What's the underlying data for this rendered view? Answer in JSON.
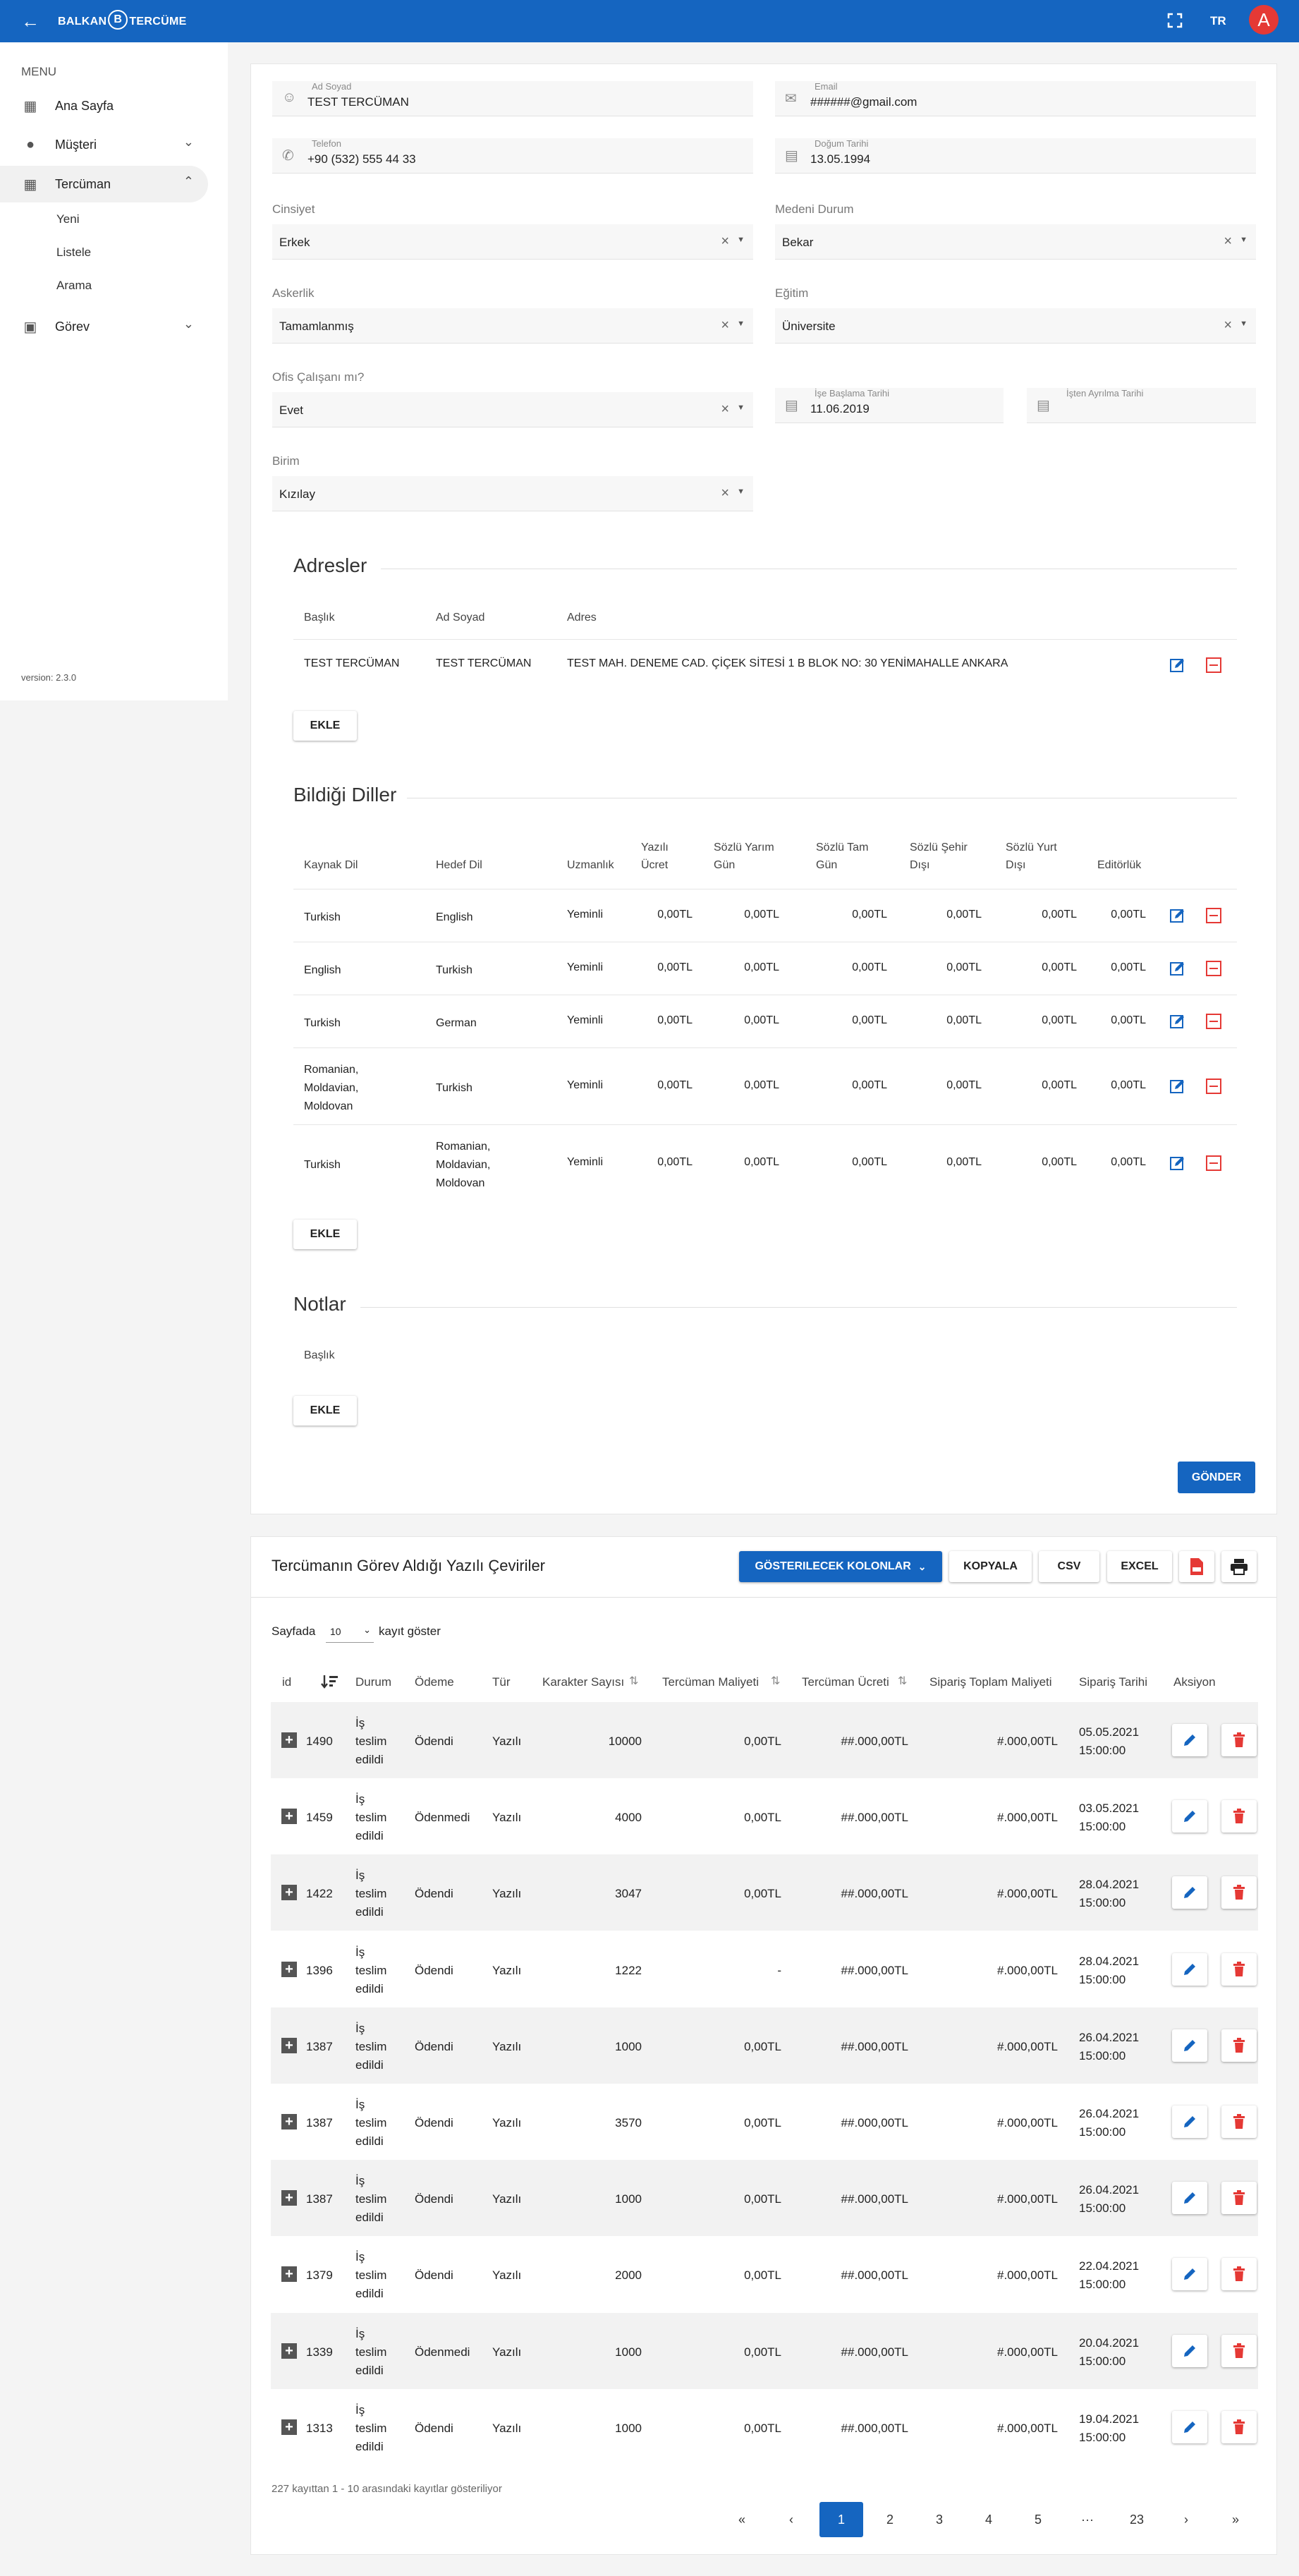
{
  "app": {
    "brand_left": "BALKAN",
    "brand_mid": "B",
    "brand_right": "TERCÜME",
    "lang": "TR",
    "avatar": "A",
    "fullscreen_icon": "fullscreen-icon",
    "back_icon": "arrow-left-icon"
  },
  "sidebar": {
    "menu_title": "MENU",
    "items": [
      {
        "label": "Ana Sayfa"
      },
      {
        "label": "Müşteri"
      },
      {
        "label": "Tercüman"
      },
      {
        "label": "Görev"
      }
    ],
    "sub": [
      "Yeni",
      "Listele",
      "Arama"
    ],
    "version": "version: 2.3.0"
  },
  "form": {
    "ad_soyad": {
      "label": "Ad Soyad",
      "value": "TEST TERCÜMAN"
    },
    "email": {
      "label": "Email",
      "value": "######@gmail.com"
    },
    "telefon": {
      "label": "Telefon",
      "value": "+90 (532) 555 44 33"
    },
    "dogum": {
      "label": "Doğum Tarihi",
      "value": "13.05.1994"
    },
    "cinsiyet": {
      "label": "Cinsiyet",
      "value": "Erkek"
    },
    "medeni": {
      "label": "Medeni Durum",
      "value": "Bekar"
    },
    "askerlik": {
      "label": "Askerlik",
      "value": "Tamamlanmış"
    },
    "egitim": {
      "label": "Eğitim",
      "value": "Üniversite"
    },
    "ofis": {
      "label": "Ofis Çalışanı mı?",
      "value": "Evet"
    },
    "ise_baslama": {
      "label": "İşe Başlama Tarihi",
      "value": "11.06.2019"
    },
    "isten_ayrilma": {
      "label": "İşten Ayrılma Tarihi",
      "value": ""
    },
    "birim": {
      "label": "Birim",
      "value": "Kızılay"
    }
  },
  "adresler": {
    "title": "Adresler",
    "headers": [
      "Başlık",
      "Ad Soyad",
      "Adres"
    ],
    "row": [
      "TEST TERCÜMAN",
      "TEST TERCÜMAN",
      "TEST MAH. DENEME CAD. ÇİÇEK SİTESİ 1 B BLOK NO: 30 YENİMAHALLE ANKARA"
    ],
    "add": "EKLE"
  },
  "diller": {
    "title": "Bildiği Diller",
    "headers": [
      "Kaynak Dil",
      "Hedef Dil",
      "Uzmanlık",
      "Yazılı",
      "Ücret",
      "Sözlü Yarım",
      "Gün",
      "Sözlü Tam",
      "Gün",
      "Sözlü Şehir",
      "Dışı",
      "Sözlü Yurt",
      "Dışı",
      "Editörlük"
    ],
    "rows": [
      {
        "src": "Turkish",
        "dst": "English",
        "uz": "Yeminli",
        "v": [
          "0,00TL",
          "0,00TL",
          "0,00TL",
          "0,00TL",
          "0,00TL",
          "0,00TL"
        ]
      },
      {
        "src": "English",
        "dst": "Turkish",
        "uz": "Yeminli",
        "v": [
          "0,00TL",
          "0,00TL",
          "0,00TL",
          "0,00TL",
          "0,00TL",
          "0,00TL"
        ]
      },
      {
        "src": "Turkish",
        "dst": "German",
        "uz": "Yeminli",
        "v": [
          "0,00TL",
          "0,00TL",
          "0,00TL",
          "0,00TL",
          "0,00TL",
          "0,00TL"
        ]
      },
      {
        "src": "Romanian,\nMoldavian,\nMoldovan",
        "dst": "Turkish",
        "uz": "Yeminli",
        "v": [
          "0,00TL",
          "0,00TL",
          "0,00TL",
          "0,00TL",
          "0,00TL",
          "0,00TL"
        ]
      },
      {
        "src": "Turkish",
        "dst": "Romanian,\nMoldavian,\nMoldovan",
        "uz": "Yeminli",
        "v": [
          "0,00TL",
          "0,00TL",
          "0,00TL",
          "0,00TL",
          "0,00TL",
          "0,00TL"
        ]
      }
    ],
    "add": "EKLE"
  },
  "notlar": {
    "title": "Notlar",
    "header": "Başlık",
    "add": "EKLE"
  },
  "submit": "GÖNDER",
  "gorev": {
    "title": "Tercümanın Görev Aldığı Yazılı Çeviriler",
    "buttons": {
      "cols": "GÖSTERILECEK KOLONLAR",
      "copy": "KOPYALA",
      "csv": "CSV",
      "excel": "EXCEL"
    },
    "length": {
      "pre": "Sayfada",
      "value": "10",
      "post": "kayıt göster"
    },
    "headers": [
      "id",
      "Durum",
      "Ödeme",
      "Tür",
      "Karakter Sayısı",
      "Tercüman Maliyeti",
      "Tercüman Ücreti",
      "Sipariş Toplam Maliyeti",
      "Sipariş Tarihi",
      "Aksiyon"
    ],
    "rows": [
      {
        "id": "1490",
        "durum": "İş\nteslim\nedildi",
        "odeme": "Ödendi",
        "tur": "Yazılı",
        "kar": "10000",
        "mal": "0,00TL",
        "ucr": "##.000,00TL",
        "top": "#.000,00TL",
        "tar": "05.05.2021\n15:00:00"
      },
      {
        "id": "1459",
        "durum": "İş\nteslim\nedildi",
        "odeme": "Ödenmedi",
        "tur": "Yazılı",
        "kar": "4000",
        "mal": "0,00TL",
        "ucr": "##.000,00TL",
        "top": "#.000,00TL",
        "tar": "03.05.2021\n15:00:00"
      },
      {
        "id": "1422",
        "durum": "İş\nteslim\nedildi",
        "odeme": "Ödendi",
        "tur": "Yazılı",
        "kar": "3047",
        "mal": "0,00TL",
        "ucr": "##.000,00TL",
        "top": "#.000,00TL",
        "tar": "28.04.2021\n15:00:00"
      },
      {
        "id": "1396",
        "durum": "İş\nteslim\nedildi",
        "odeme": "Ödendi",
        "tur": "Yazılı",
        "kar": "1222",
        "mal": "-",
        "ucr": "##.000,00TL",
        "top": "#.000,00TL",
        "tar": "28.04.2021\n15:00:00"
      },
      {
        "id": "1387",
        "durum": "İş\nteslim\nedildi",
        "odeme": "Ödendi",
        "tur": "Yazılı",
        "kar": "1000",
        "mal": "0,00TL",
        "ucr": "##.000,00TL",
        "top": "#.000,00TL",
        "tar": "26.04.2021\n15:00:00"
      },
      {
        "id": "1387",
        "durum": "İş\nteslim\nedildi",
        "odeme": "Ödendi",
        "tur": "Yazılı",
        "kar": "3570",
        "mal": "0,00TL",
        "ucr": "##.000,00TL",
        "top": "#.000,00TL",
        "tar": "26.04.2021\n15:00:00"
      },
      {
        "id": "1387",
        "durum": "İş\nteslim\nedildi",
        "odeme": "Ödendi",
        "tur": "Yazılı",
        "kar": "1000",
        "mal": "0,00TL",
        "ucr": "##.000,00TL",
        "top": "#.000,00TL",
        "tar": "26.04.2021\n15:00:00"
      },
      {
        "id": "1379",
        "durum": "İş\nteslim\nedildi",
        "odeme": "Ödendi",
        "tur": "Yazılı",
        "kar": "2000",
        "mal": "0,00TL",
        "ucr": "##.000,00TL",
        "top": "#.000,00TL",
        "tar": "22.04.2021\n15:00:00"
      },
      {
        "id": "1339",
        "durum": "İş\nteslim\nedildi",
        "odeme": "Ödenmedi",
        "tur": "Yazılı",
        "kar": "1000",
        "mal": "0,00TL",
        "ucr": "##.000,00TL",
        "top": "#.000,00TL",
        "tar": "20.04.2021\n15:00:00"
      },
      {
        "id": "1313",
        "durum": "İş\nteslim\nedildi",
        "odeme": "Ödendi",
        "tur": "Yazılı",
        "kar": "1000",
        "mal": "0,00TL",
        "ucr": "##.000,00TL",
        "top": "#.000,00TL",
        "tar": "19.04.2021\n15:00:00"
      }
    ],
    "info": "227 kayıttan 1 - 10 arasındaki kayıtlar gösteriliyor",
    "pages": [
      "«",
      "‹",
      "1",
      "2",
      "3",
      "4",
      "5",
      "···",
      "23",
      "›",
      "»"
    ]
  },
  "colors": {
    "primary": "#1565c0",
    "danger": "#e53935"
  }
}
